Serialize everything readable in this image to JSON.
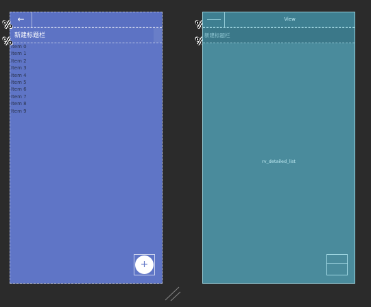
{
  "design": {
    "toolbar": {
      "back_icon": "←"
    },
    "title_bar": {
      "title": "新建标题栏"
    },
    "list_items": [
      "Item 0",
      "Item 1",
      "Item 2",
      "Item 3",
      "Item 4",
      "Item 5",
      "Item 6",
      "Item 7",
      "Item 8",
      "Item 9"
    ],
    "fab": {
      "icon": "+"
    }
  },
  "markers": {
    "symbol": "%"
  },
  "blueprint": {
    "toolbar": {
      "view_label": "View"
    },
    "title_bar": {
      "title": "新建标题栏"
    },
    "list_label": "rv_detailed_list"
  },
  "colors": {
    "canvas": "#2b2b2b",
    "design_panel": "#5f75c6",
    "blueprint_panel": "#4a8b9c"
  }
}
